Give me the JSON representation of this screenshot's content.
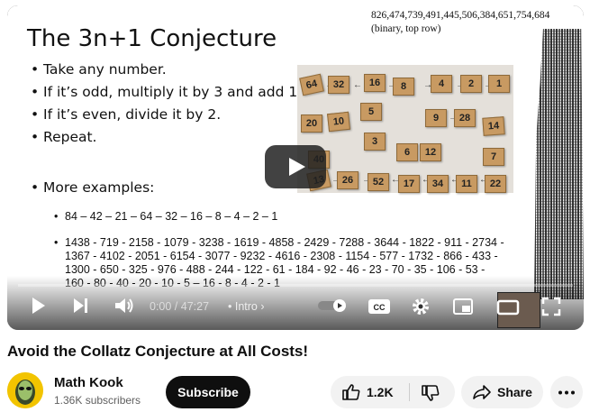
{
  "slide": {
    "title": "The 3n+1 Conjecture",
    "top_number": "826,474,739,491,445,506,384,651,754,684",
    "top_caption": "(binary, top row)",
    "bullets": [
      "Take any number.",
      "If it’s odd, multiply it by 3 and add 1.",
      "If it’s even, divide it by 2.",
      "Repeat."
    ],
    "more_examples_label": "More examples:",
    "example1": "84 – 42 – 21 – 64 – 32 – 16 – 8 – 4 – 2 – 1",
    "example2": "1438 - 719 - 2158 - 1079 - 3238 - 1619 - 4858 - 2429 - 7288 - 3644 - 1822 - 911 - 2734 - 1367 - 4102 - 2051 - 6154 - 3077 - 9232 - 4616 - 2308 - 1154 - 577 - 1732 - 866 - 433 - 1300 - 650 - 325 - 976 - 488 - 244 - 122 - 61 - 184 - 92 - 46 - 23 - 70 - 35 - 106 - 53 - 160 - 80 - 40 - 20 - 10 - 5 – 16 - 8 - 4 - 2 - 1",
    "tiles": [
      "64",
      "32",
      "16",
      "8",
      "4",
      "2",
      "1",
      "20",
      "10",
      "5",
      "9",
      "28",
      "14",
      "3",
      "6",
      "12",
      "7",
      "40",
      "13",
      "26",
      "52",
      "17",
      "34",
      "11",
      "22"
    ]
  },
  "player": {
    "time": "0:00 / 47:27",
    "chapter": "• Intro"
  },
  "video": {
    "title": "Avoid the Collatz Conjecture at All Costs!"
  },
  "channel": {
    "name": "Math Kook",
    "subscribers": "1.36K subscribers",
    "subscribe_label": "Subscribe"
  },
  "actions": {
    "like_count": "1.2K",
    "share_label": "Share"
  },
  "icons": {
    "play": "play-icon",
    "next": "next-icon",
    "volume": "volume-icon",
    "autoplay": "autoplay-toggle-icon",
    "captions": "captions-icon",
    "settings": "gear-icon",
    "miniplayer": "miniplayer-icon",
    "theater": "theater-icon",
    "fullscreen": "fullscreen-icon",
    "like": "thumbs-up-icon",
    "dislike": "thumbs-down-icon",
    "share": "share-icon",
    "more": "more-horizontal-icon"
  }
}
